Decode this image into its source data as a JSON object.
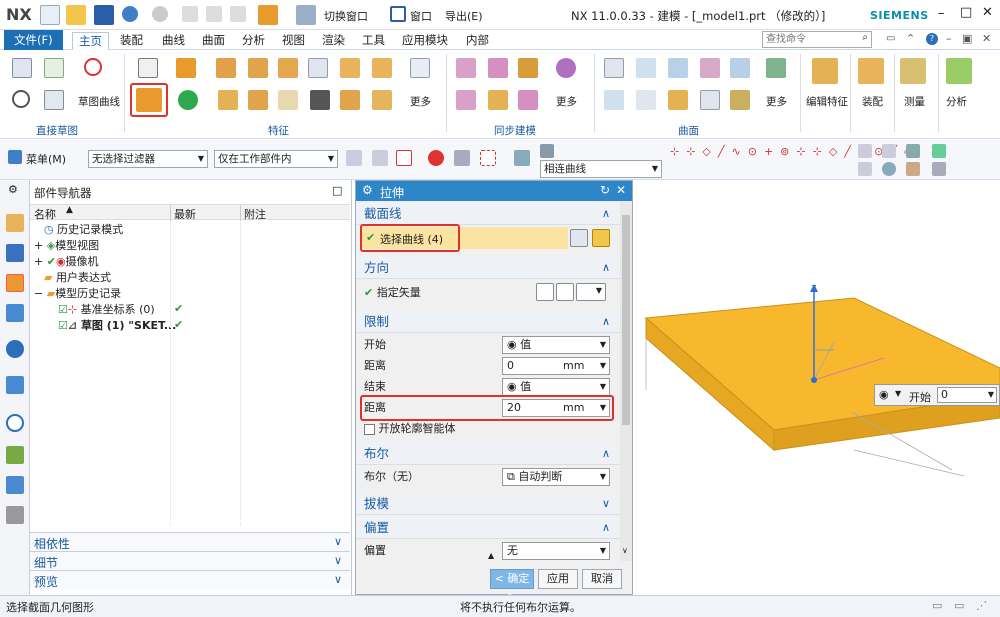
{
  "app": {
    "logo": "NX",
    "title": "NX 11.0.0.33 - 建模 - [_model1.prt （修改的）]",
    "brand": "SIEMENS",
    "switch_window": "切换窗口",
    "window_menu": "窗口",
    "export_menu": "导出(E)"
  },
  "tabs": [
    "文件(F)",
    "主页",
    "装配",
    "曲线",
    "曲面",
    "分析",
    "视图",
    "渲染",
    "工具",
    "应用模块",
    "内部"
  ],
  "search": {
    "placeholder": "查找命令"
  },
  "ribbon": {
    "groups": {
      "direct_sketch": "直接草图",
      "feature": "特征",
      "sync": "同步建模",
      "surface": "曲面"
    },
    "sketch_curve": "草图曲线",
    "more1": "更多",
    "more2": "更多",
    "more3": "更多",
    "edit_feature": "编辑特征",
    "assembly": "装配",
    "measure": "测量",
    "analysis": "分析"
  },
  "toolbar2": {
    "menu": "菜单(M)",
    "filter": "无选择过滤器",
    "scope": "仅在工作部件内",
    "curve_rule": "相连曲线"
  },
  "navigator": {
    "title": "部件导航器",
    "cols": [
      "名称",
      "最新",
      "附注"
    ],
    "rows": [
      {
        "label": "历史记录模式",
        "check": ""
      },
      {
        "label": "模型视图",
        "check": ""
      },
      {
        "label": "摄像机",
        "check": ""
      },
      {
        "label": "用户表达式",
        "check": ""
      },
      {
        "label": "模型历史记录",
        "check": ""
      },
      {
        "label": "基准坐标系 (0)",
        "check": "✔"
      },
      {
        "label": "草图 (1) \"SKET...",
        "check": "✔"
      }
    ],
    "bottom": [
      "相依性",
      "细节",
      "预览"
    ]
  },
  "dialog": {
    "title": "拉伸",
    "sections": {
      "section_curve": "截面线",
      "direction": "方向",
      "limits": "限制",
      "bool": "布尔",
      "draft": "拔模",
      "offset": "偏置"
    },
    "select_curve": "选择曲线 (4)",
    "specify_vector": "指定矢量",
    "start_label": "开始",
    "start_value": "值",
    "distance1_label": "距离",
    "distance1": "0",
    "unit1": "mm",
    "end_label": "结束",
    "end_value": "值",
    "distance2_label": "距离",
    "distance2": "20",
    "unit2": "mm",
    "open_profile": "开放轮廓智能体",
    "bool_label": "布尔（无）",
    "bool_value": "自动判断",
    "offset_label": "偏置",
    "offset_value": "无",
    "ok": "< 确定 >",
    "apply": "应用",
    "cancel": "取消"
  },
  "viewport": {
    "start_label": "开始",
    "start_value": "0",
    "axis_z": "Z"
  },
  "status": {
    "left": "选择截面几何图形",
    "center": "将不执行任何布尔运算。"
  }
}
